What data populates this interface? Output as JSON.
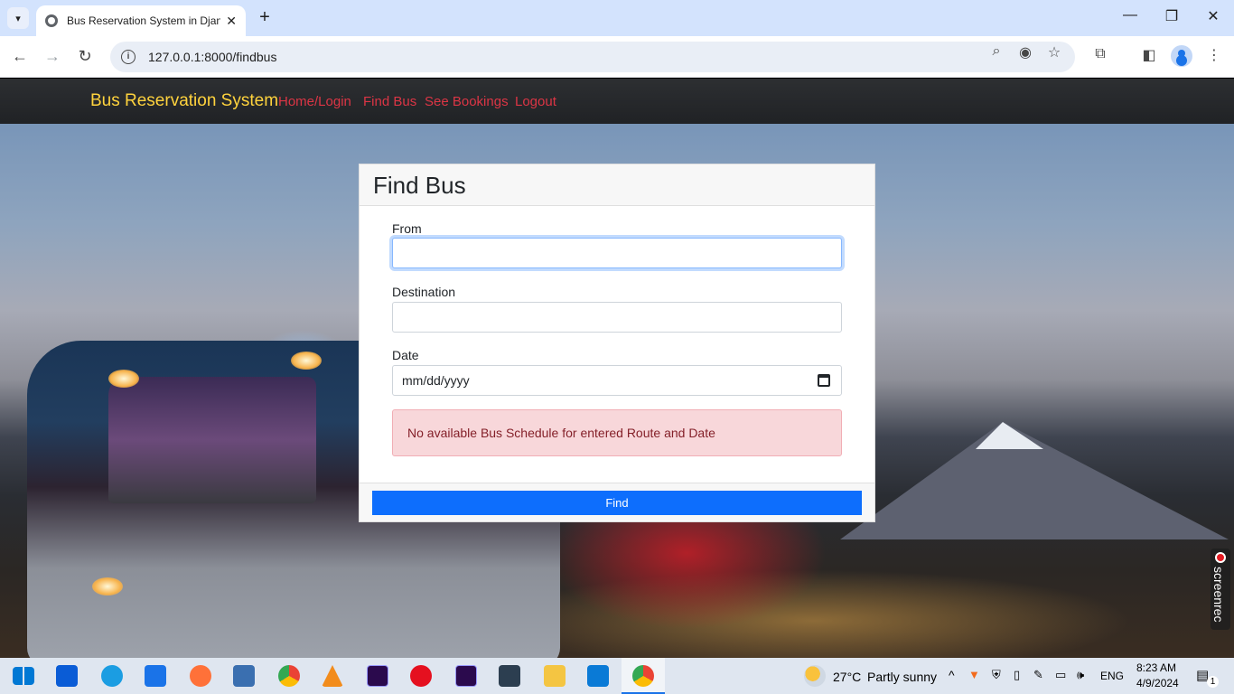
{
  "browser": {
    "tab_title": "Bus Reservation System in Djan",
    "tab_close": "✕",
    "new_tab": "+",
    "url": "127.0.0.1:8000/findbus",
    "window_controls": {
      "minimize": "—",
      "restore": "❐",
      "close": "✕"
    }
  },
  "navbar": {
    "brand": "Bus Reservation System",
    "links": [
      "Home/Login",
      "Find Bus",
      "See Bookings",
      "Logout"
    ],
    "brand_color": "#ffd33d",
    "link_color": "#dc3545"
  },
  "form": {
    "title": "Find Bus",
    "from_label": "From",
    "from_value": "",
    "destination_label": "Destination",
    "destination_value": "",
    "date_label": "Date",
    "date_placeholder": "mm/dd/yyyy",
    "alert": "No available Bus Schedule for entered Route and Date",
    "submit": "Find"
  },
  "overlay": {
    "screenrec_label": "screenrec"
  },
  "taskbar": {
    "weather_temp": "27°C",
    "weather_text": "Partly sunny",
    "language": "ENG",
    "time": "8:23 AM",
    "date": "4/9/2024",
    "notifications": "1",
    "apps": [
      "start-icon",
      "store-icon",
      "edge-icon",
      "mail-icon",
      "firefox-icon",
      "media-icon",
      "chrome-icon",
      "vlc-icon",
      "after-effects-icon",
      "opera-icon",
      "after-effects-icon",
      "terminal-icon",
      "file-explorer-icon",
      "vscode-icon",
      "chrome-icon"
    ]
  }
}
